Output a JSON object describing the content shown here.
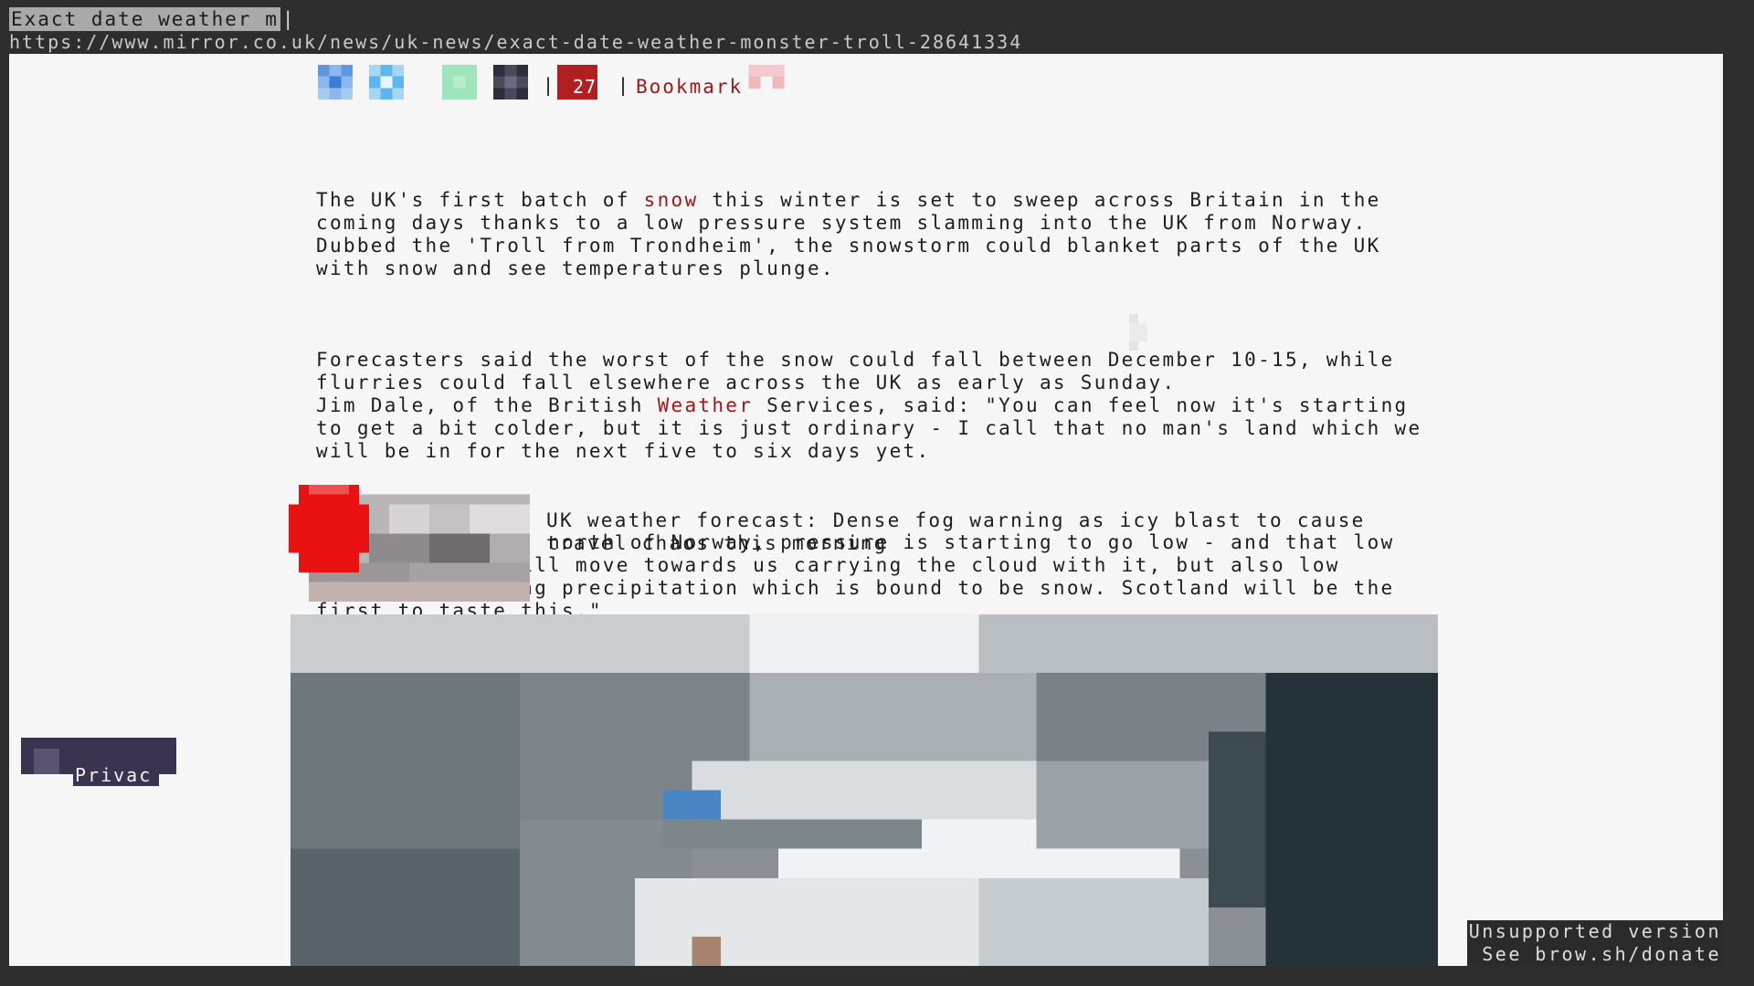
{
  "tab": {
    "title": "Exact date weather m",
    "cursor": "|"
  },
  "address": {
    "url": "https://www.mirror.co.uk/news/uk-news/exact-date-weather-monster-troll-28641334"
  },
  "share": {
    "separator": "|",
    "comment_count": "27",
    "bookmark_label": "Bookmark",
    "icons": [
      "facebook-icon",
      "twitter-icon",
      "whatsapp-icon",
      "email-icon",
      "comment-icon",
      "bookmark-icon"
    ]
  },
  "article": {
    "p1": [
      "The UK's first batch of ",
      "snow",
      " this winter is set to sweep across Britain in the coming days thanks to a low pressure system slamming into the UK from Norway."
    ],
    "p1b": "Dubbed the 'Troll from Trondheim', the snowstorm could blanket parts of the UK with snow and see temperatures plunge.",
    "p2": "Forecasters said the worst of the snow could fall between December 10-15, while flurries could fall elsewhere across the UK as early as Sunday.",
    "p2b": [
      "Jim Dale, of the British ",
      "Weather",
      " Services, said: \"You can feel now it's starting to get a bit colder, but it is just ordinary - I call that no man's land which we will be in for the next five to six days yet."
    ],
    "p3": "\"In Scandinavia, north of Norway, pressure is starting to go low - and that low elongates and will move towards us carrying the cloud with it, but also low pressure bringing precipitation which is bound to be snow. Scotland will be the first to taste this.\""
  },
  "related": {
    "headline": "UK weather forecast: Dense fog warning as icy blast to cause travel chaos this morning"
  },
  "privacy": {
    "label": "Privac"
  },
  "notice": {
    "line1": "Unsupported version",
    "line2": "See brow.sh/donate"
  },
  "colors": {
    "link": "#a01818",
    "page_bg": "#f5f6f5",
    "chrome_bg": "#2e2e2e"
  }
}
